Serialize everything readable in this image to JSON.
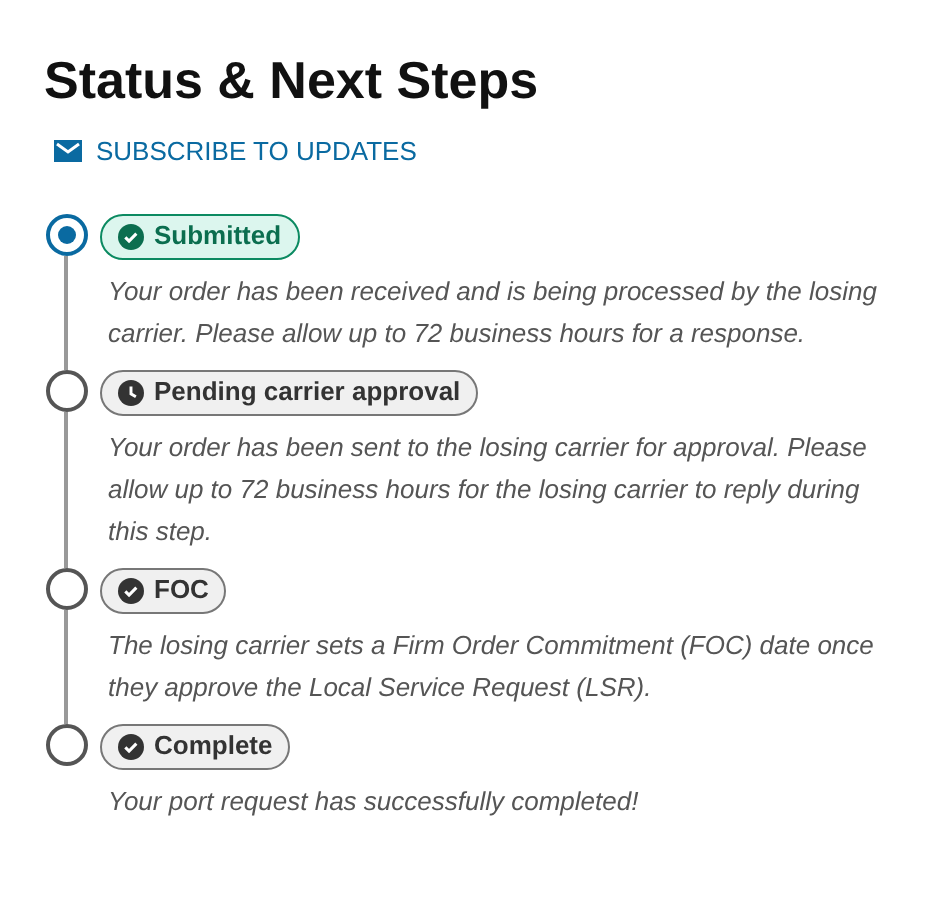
{
  "title": "Status & Next Steps",
  "subscribe_link": "SUBSCRIBE TO UPDATES",
  "steps": [
    {
      "label": "Submitted",
      "kind": "done",
      "selected": true,
      "description": "Your order has been received and is being processed by the losing carrier. Please allow up to 72 business hours for a response."
    },
    {
      "label": "Pending carrier approval",
      "kind": "pending",
      "selected": false,
      "description": "Your order has been sent to the losing carrier for approval. Please allow up to 72 business hours for the losing carrier to reply during this step."
    },
    {
      "label": "FOC",
      "kind": "done",
      "selected": false,
      "description": "The losing carrier sets a Firm Order Commitment (FOC) date once they approve the Local Service Request (LSR)."
    },
    {
      "label": "Complete",
      "kind": "done",
      "selected": false,
      "description": "Your port request has successfully completed!"
    }
  ]
}
